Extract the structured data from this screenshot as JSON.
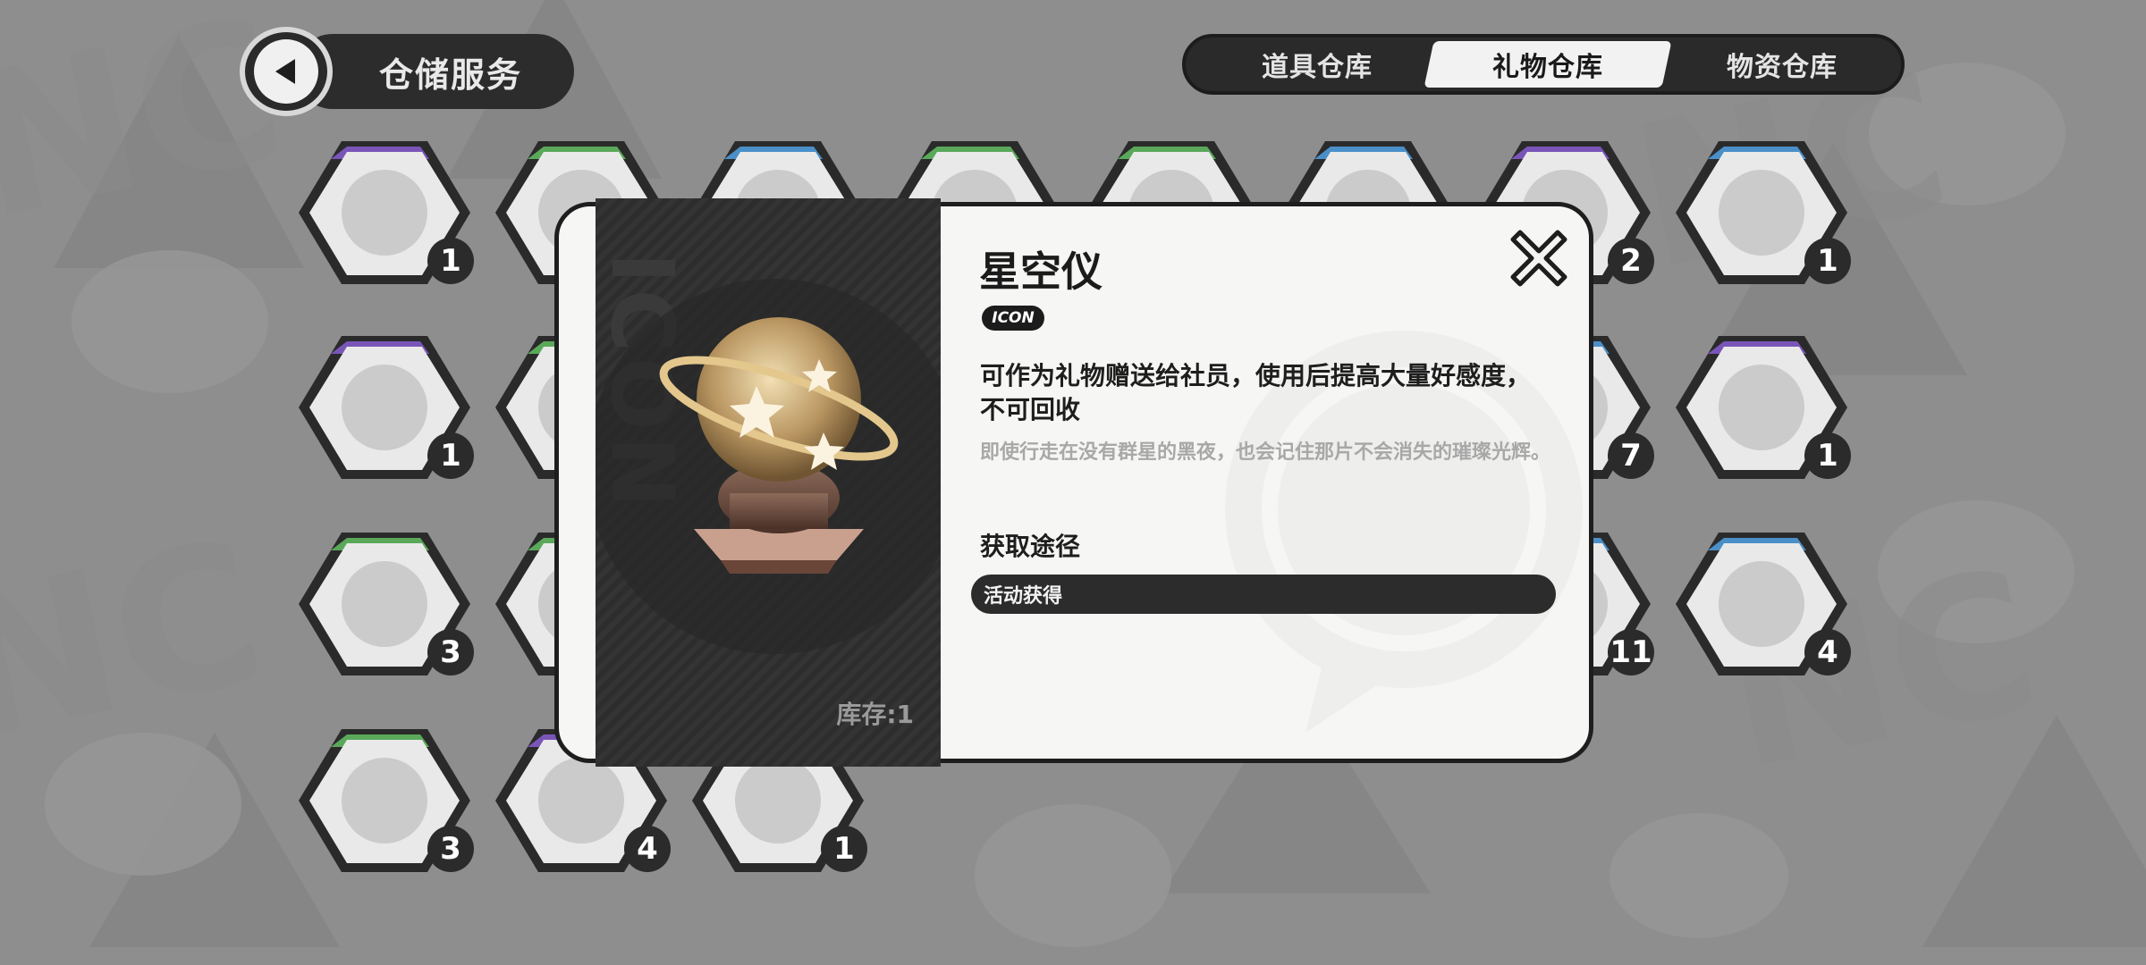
{
  "header": {
    "back_icon": "back-arrow-icon",
    "title": "仓储服务"
  },
  "tabs": [
    {
      "label": "道具仓库",
      "active": false
    },
    {
      "label": "礼物仓库",
      "active": true
    },
    {
      "label": "物资仓库",
      "active": false
    }
  ],
  "grid": {
    "tiles": [
      {
        "icon": "strawberry-crepe-icon",
        "count": "1",
        "accent": "#7a55b8"
      },
      {
        "icon": "anime-magazine-icon",
        "count": "",
        "accent": "#5aa85a"
      },
      {
        "icon": "anime-card-icon",
        "count": "",
        "accent": "#4a8fc8"
      },
      {
        "icon": "anime-book-icon",
        "count": "",
        "accent": "#5aa85a"
      },
      {
        "icon": "movie-poster-icon",
        "count": "",
        "accent": "#5aa85a"
      },
      {
        "icon": "hero-comic-icon",
        "count": "",
        "accent": "#4a8fc8"
      },
      {
        "icon": "anime-poster-icon",
        "count": "2",
        "accent": "#7a55b8"
      },
      {
        "icon": "pink-dress-icon",
        "count": "1",
        "accent": "#4a8fc8"
      },
      {
        "icon": "cat-mascot-icon",
        "count": "1",
        "accent": "#7a55b8"
      },
      {
        "icon": "cap-icon",
        "count": "",
        "accent": "#5aa85a"
      },
      {
        "icon": "game-console-handheld-icon",
        "count": "7",
        "accent": "#4a8fc8"
      },
      {
        "icon": "game-console-icon",
        "count": "1",
        "accent": "#7a55b8"
      },
      {
        "icon": "laptop-icon",
        "count": "3",
        "accent": "#5aa85a"
      },
      {
        "icon": "headphones-icon",
        "count": "",
        "accent": "#5aa85a"
      },
      {
        "icon": "tissue-box-icon",
        "count": "11",
        "accent": "#4a8fc8"
      },
      {
        "icon": "bowl-icon",
        "count": "4",
        "accent": "#4a8fc8"
      },
      {
        "icon": "baseball-bat-icon",
        "count": "3",
        "accent": "#5aa85a"
      },
      {
        "icon": "star-globe-icon",
        "count": "4",
        "accent": "#7a55b8"
      },
      {
        "icon": "star-globe-icon",
        "count": "1",
        "accent": "#4a8fc8"
      }
    ]
  },
  "modal": {
    "name": "星空仪",
    "brand": "ICON",
    "description": "可作为礼物赠送给社员，使用后提高大量好感度，不可回收",
    "flavor": "即使行走在没有群星的黑夜，也会记住那片不会消失的璀璨光辉。",
    "source_title": "获取途径",
    "source_item": "活动获得",
    "stock_label": "库存:1",
    "item_icon": "star-globe-icon",
    "close_icon": "close-x-icon"
  },
  "colors": {
    "background": "#8d8d8d",
    "panel_dark": "#2c2c2c",
    "panel_light": "#f6f6f4",
    "rarity_purple": "#7a55b8",
    "rarity_green": "#5aa85a",
    "rarity_blue": "#4a8fc8"
  }
}
